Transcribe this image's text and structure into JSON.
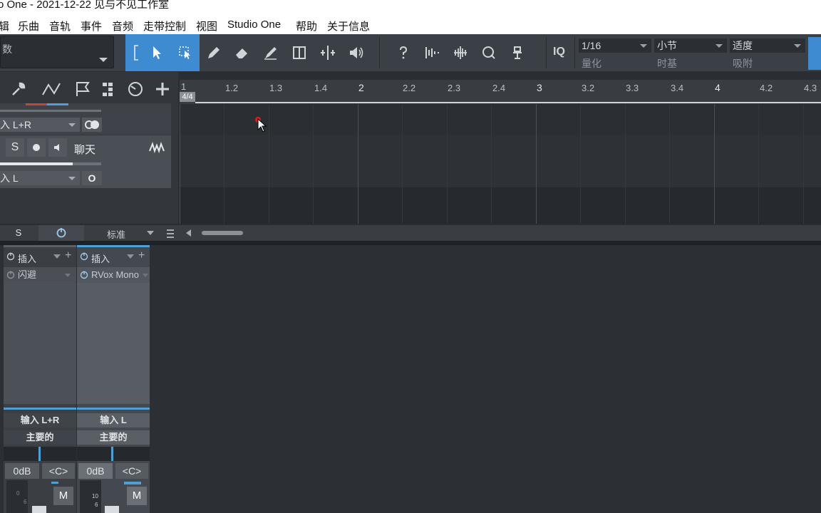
{
  "window": {
    "title": "o One - 2021-12-22 见与不见工作室"
  },
  "menu": [
    "辑",
    "乐曲",
    "音轨",
    "事件",
    "音频",
    "走带控制",
    "视图",
    "Studio One",
    "帮助",
    "关于信息"
  ],
  "toolbar": {
    "left_label": "数",
    "quantize": {
      "value": "1/16",
      "label": "量化"
    },
    "timebase": {
      "value": "小节",
      "label": "时基"
    },
    "snap": {
      "value": "适度",
      "label": "吸附"
    },
    "iq_label": "IQ"
  },
  "ruler": {
    "time_signature": "4/4",
    "ticks": [
      "1",
      "1.2",
      "1.3",
      "1.4",
      "2",
      "2.2",
      "2.3",
      "2.4",
      "3",
      "3.2",
      "3.3",
      "3.4",
      "4",
      "4.2",
      "4.3"
    ]
  },
  "tracks": [
    {
      "input": "入 L+R"
    },
    {
      "solo": "S",
      "name": "聊天",
      "input": "入 L",
      "monitor": "O"
    }
  ],
  "status_row": {
    "solo": "S",
    "view": "标准"
  },
  "mixer": {
    "channels": [
      {
        "insert_label": "插入",
        "insert_slot": "闪避",
        "input": "输入 L+R",
        "output": "主要的",
        "volume": "0dB",
        "pan": "<C>",
        "mute": "M"
      },
      {
        "insert_label": "插入",
        "insert_slot": "RVox Mono",
        "input": "输入 L",
        "output": "主要的",
        "volume": "0dB",
        "pan": "<C>",
        "mute": "M",
        "meter_labels": [
          "10",
          "6"
        ]
      }
    ]
  },
  "colors": {
    "accent": "#3e8bd1",
    "record": "#d12222"
  }
}
